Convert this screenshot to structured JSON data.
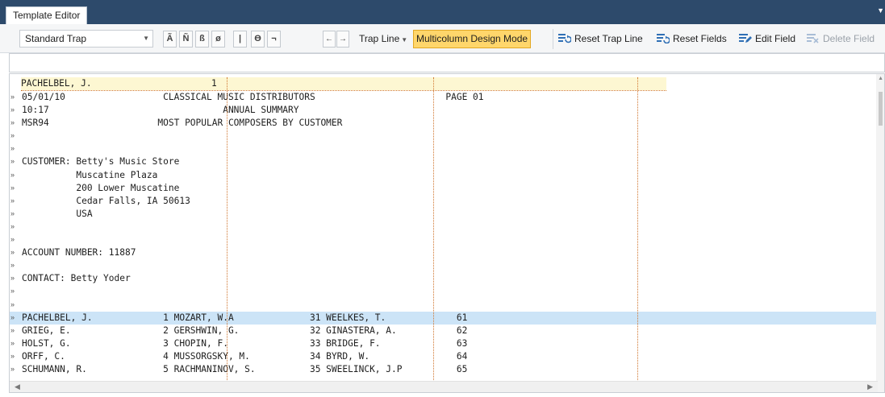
{
  "window": {
    "tab_title": "Template Editor"
  },
  "toolbar": {
    "trap_combo": "Standard Trap",
    "char_buttons": [
      "Ã",
      "Ñ",
      "ß",
      "ø",
      "|",
      "ϴ",
      "¬"
    ],
    "arrow_left": "←",
    "arrow_right": "→",
    "trap_line_label": "Trap Line",
    "multicolumn_label": "Multicolumn Design Mode",
    "reset_trap_line_label": "Reset Trap Line",
    "reset_fields_label": "Reset Fields",
    "edit_field_label": "Edit Field",
    "delete_field_label": "Delete Field"
  },
  "trap_header": {
    "name": "PACHELBEL, J.",
    "num": "1"
  },
  "report_lines": [
    {
      "text": "05/01/10                  CLASSICAL MUSIC DISTRIBUTORS                        PAGE 01",
      "selected": false
    },
    {
      "text": "10:17                                ANNUAL SUMMARY",
      "selected": false
    },
    {
      "text": "MSR94                    MOST POPULAR COMPOSERS BY CUSTOMER",
      "selected": false
    },
    {
      "text": "",
      "selected": false
    },
    {
      "text": "",
      "selected": false
    },
    {
      "text": "CUSTOMER: Betty's Music Store",
      "selected": false
    },
    {
      "text": "          Muscatine Plaza",
      "selected": false
    },
    {
      "text": "          200 Lower Muscatine",
      "selected": false
    },
    {
      "text": "          Cedar Falls, IA 50613",
      "selected": false
    },
    {
      "text": "          USA",
      "selected": false
    },
    {
      "text": "",
      "selected": false
    },
    {
      "text": "",
      "selected": false
    },
    {
      "text": "ACCOUNT NUMBER: 11887",
      "selected": false
    },
    {
      "text": "",
      "selected": false
    },
    {
      "text": "CONTACT: Betty Yoder",
      "selected": false
    },
    {
      "text": "",
      "selected": false
    },
    {
      "text": "",
      "selected": false
    },
    {
      "text": "PACHELBEL, J.             1 MOZART, W.A              31 WEELKES, T.             61",
      "selected": true
    },
    {
      "text": "GRIEG, E.                 2 GERSHWIN, G.             32 GINASTERA, A.           62",
      "selected": false
    },
    {
      "text": "HOLST, G.                 3 CHOPIN, F.               33 BRIDGE, F.              63",
      "selected": false
    },
    {
      "text": "ORFF, C.                  4 MUSSORGSKY, M.           34 BYRD, W.                64",
      "selected": false
    },
    {
      "text": "SCHUMANN, R.              5 RACHMANINOV, S.          35 SWEELINCK, J.P          65",
      "selected": false
    }
  ],
  "colors": {
    "tabbar": "#2d4a6b",
    "highlight": "#ffd66b",
    "selected_row": "#cce4f7",
    "trap_line_bg": "#fdf7d2",
    "column_guides": "#d0752e"
  }
}
